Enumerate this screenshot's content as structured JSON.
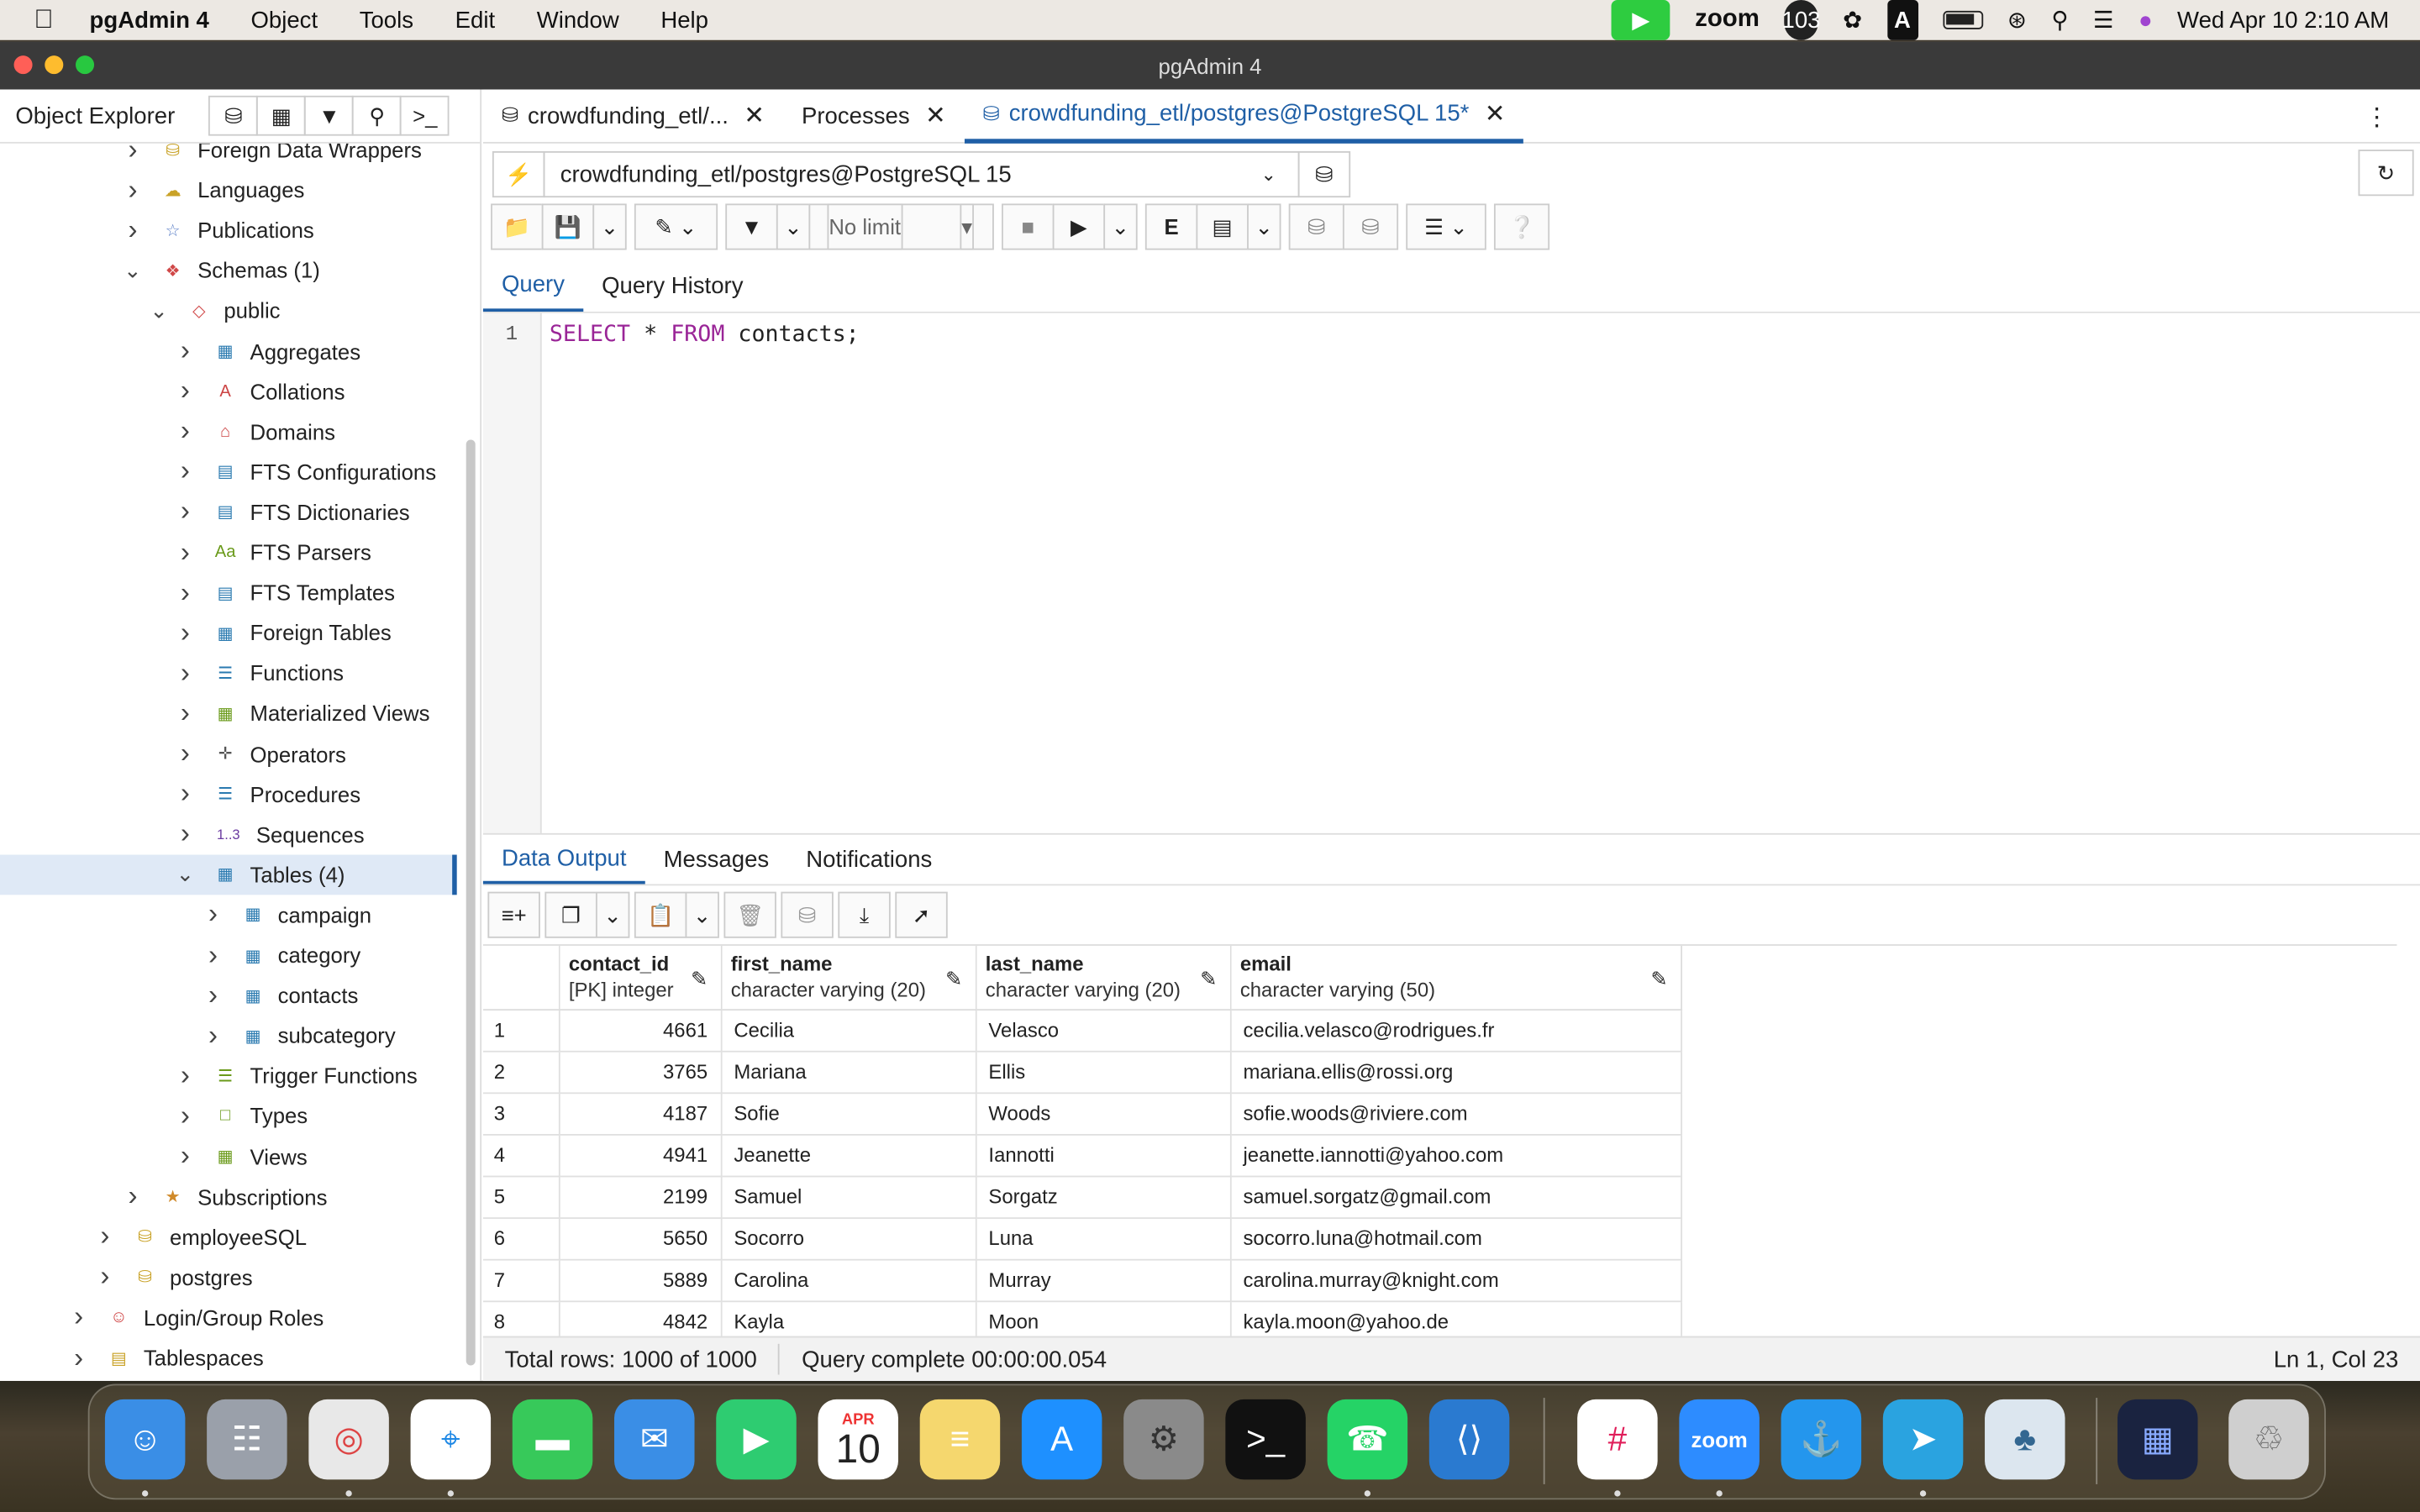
{
  "menubar": {
    "app": "pgAdmin 4",
    "items": [
      "Object",
      "Tools",
      "Edit",
      "Window",
      "Help"
    ],
    "zoom": "zoom",
    "badge": "103",
    "input": "A",
    "datetime": "Wed Apr 10  2:10 AM"
  },
  "window": {
    "title": "pgAdmin 4"
  },
  "object_explorer": {
    "title": "Object Explorer",
    "tree": [
      {
        "label": "Foreign Data Wrappers",
        "icon": "foreign-data-wrapper-icon"
      },
      {
        "label": "Languages",
        "icon": "language-icon"
      },
      {
        "label": "Publications",
        "icon": "publication-icon"
      },
      {
        "label": "Schemas (1)",
        "icon": "schemas-icon"
      },
      {
        "label": "public",
        "icon": "schema-icon"
      },
      {
        "label": "Aggregates",
        "icon": "aggregate-icon"
      },
      {
        "label": "Collations",
        "icon": "collation-icon"
      },
      {
        "label": "Domains",
        "icon": "domain-icon"
      },
      {
        "label": "FTS Configurations",
        "icon": "fts-configuration-icon"
      },
      {
        "label": "FTS Dictionaries",
        "icon": "fts-dictionary-icon"
      },
      {
        "label": "FTS Parsers",
        "icon": "fts-parser-icon"
      },
      {
        "label": "FTS Templates",
        "icon": "fts-template-icon"
      },
      {
        "label": "Foreign Tables",
        "icon": "foreign-table-icon"
      },
      {
        "label": "Functions",
        "icon": "function-icon"
      },
      {
        "label": "Materialized Views",
        "icon": "materialized-view-icon"
      },
      {
        "label": "Operators",
        "icon": "operator-icon"
      },
      {
        "label": "Procedures",
        "icon": "procedure-icon"
      },
      {
        "label": "Sequences",
        "icon": "sequence-icon"
      },
      {
        "label": "Tables (4)",
        "icon": "tables-icon"
      },
      {
        "label": "campaign",
        "icon": "table-icon"
      },
      {
        "label": "category",
        "icon": "table-icon"
      },
      {
        "label": "contacts",
        "icon": "table-icon"
      },
      {
        "label": "subcategory",
        "icon": "table-icon"
      },
      {
        "label": "Trigger Functions",
        "icon": "trigger-function-icon"
      },
      {
        "label": "Types",
        "icon": "type-icon"
      },
      {
        "label": "Views",
        "icon": "view-icon"
      },
      {
        "label": "Subscriptions",
        "icon": "subscription-icon"
      },
      {
        "label": "employeeSQL",
        "icon": "database-disconnected-icon"
      },
      {
        "label": "postgres",
        "icon": "database-icon"
      },
      {
        "label": "Login/Group Roles",
        "icon": "roles-icon"
      },
      {
        "label": "Tablespaces",
        "icon": "tablespace-icon"
      }
    ]
  },
  "tabs": [
    {
      "label": "crowdfunding_etl/..."
    },
    {
      "label": "Processes"
    },
    {
      "label": "crowdfunding_etl/postgres@PostgreSQL 15*"
    }
  ],
  "connection": "crowdfunding_etl/postgres@PostgreSQL 15",
  "toolbar": {
    "limit": "No limit",
    "explain": "E"
  },
  "query_tabs": [
    "Query",
    "Query History"
  ],
  "editor": {
    "line": "1",
    "tokens": [
      {
        "text": "SELECT",
        "kw": true
      },
      {
        "text": " * ",
        "kw": false
      },
      {
        "text": "FROM",
        "kw": true
      },
      {
        "text": " contacts;",
        "kw": false
      }
    ]
  },
  "output_tabs": [
    "Data Output",
    "Messages",
    "Notifications"
  ],
  "grid": {
    "columns": [
      {
        "name": "contact_id",
        "type": "[PK] integer"
      },
      {
        "name": "first_name",
        "type": "character varying (20)"
      },
      {
        "name": "last_name",
        "type": "character varying (20)"
      },
      {
        "name": "email",
        "type": "character varying (50)"
      }
    ],
    "rows": [
      [
        "1",
        "4661",
        "Cecilia",
        "Velasco",
        "cecilia.velasco@rodrigues.fr"
      ],
      [
        "2",
        "3765",
        "Mariana",
        "Ellis",
        "mariana.ellis@rossi.org"
      ],
      [
        "3",
        "4187",
        "Sofie",
        "Woods",
        "sofie.woods@riviere.com"
      ],
      [
        "4",
        "4941",
        "Jeanette",
        "Iannotti",
        "jeanette.iannotti@yahoo.com"
      ],
      [
        "5",
        "2199",
        "Samuel",
        "Sorgatz",
        "samuel.sorgatz@gmail.com"
      ],
      [
        "6",
        "5650",
        "Socorro",
        "Luna",
        "socorro.luna@hotmail.com"
      ],
      [
        "7",
        "5889",
        "Carolina",
        "Murray",
        "carolina.murray@knight.com"
      ],
      [
        "8",
        "4842",
        "Kayla",
        "Moon",
        "kayla.moon@yahoo.de"
      ]
    ]
  },
  "status": {
    "rows": "Total rows: 1000 of 1000",
    "query": "Query complete 00:00:00.054",
    "position": "Ln 1, Col 23"
  },
  "dock": {
    "calendar_month": "APR",
    "calendar_day": "10",
    "zoom_label": "zoom",
    "apps": [
      "finder-icon",
      "launchpad-icon",
      "chrome-icon",
      "safari-icon",
      "messages-icon",
      "mail-icon",
      "facetime-icon",
      "calendar-icon",
      "notes-icon",
      "app-store-icon",
      "system-settings-icon",
      "terminal-icon",
      "whatsapp-icon",
      "vscode-icon",
      "slack-icon",
      "zoom-icon",
      "docker-icon",
      "telegram-icon",
      "pgadmin-icon",
      "screenshot-icon",
      "trash-icon"
    ]
  },
  "colors": {
    "accent": "#1f5fa6",
    "keyword": "#9a2597",
    "selection": "#dfe9f6"
  }
}
